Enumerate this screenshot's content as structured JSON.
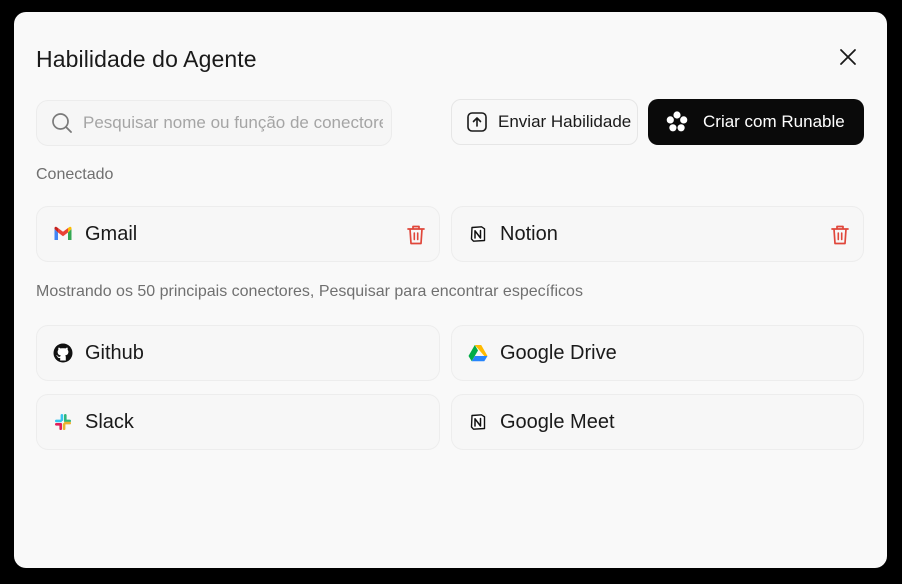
{
  "dialog": {
    "title": "Habilidade do Agente"
  },
  "search": {
    "placeholder": "Pesquisar nome ou função de conectores",
    "value": ""
  },
  "toolbar": {
    "upload_label": "Enviar Habilidade",
    "create_label": "Criar com Runable"
  },
  "connected": {
    "label": "Conectado",
    "items": [
      {
        "name": "Gmail",
        "icon": "gmail-icon"
      },
      {
        "name": "Notion",
        "icon": "notion-icon"
      }
    ]
  },
  "available": {
    "label": "Mostrando os 50 principais conectores, Pesquisar para encontrar específicos",
    "items": [
      {
        "name": "Github",
        "icon": "github-icon"
      },
      {
        "name": "Google Drive",
        "icon": "google-drive-icon"
      },
      {
        "name": "Slack",
        "icon": "slack-icon"
      },
      {
        "name": "Google Meet",
        "icon": "notion-icon"
      }
    ]
  },
  "colors": {
    "delete": "#e0463a",
    "primary_button": "#0a0a0a"
  }
}
